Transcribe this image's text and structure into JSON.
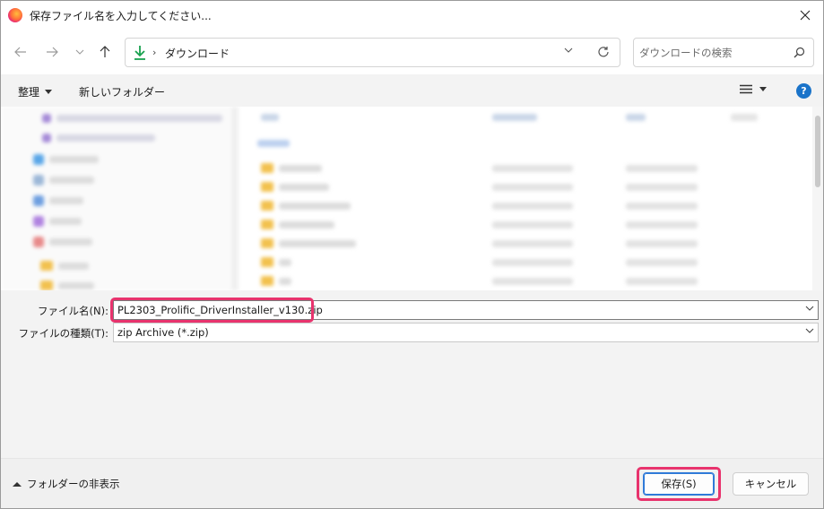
{
  "window": {
    "title": "保存ファイル名を入力してください..."
  },
  "nav": {
    "path": "ダウンロード",
    "search_placeholder": "ダウンロードの検索"
  },
  "toolbar": {
    "organize_label": "整理",
    "new_folder_label": "新しいフォルダー"
  },
  "fields": {
    "filename_label": "ファイル名(N):",
    "filename_value": "PL2303_Prolific_DriverInstaller_v130.zip",
    "filetype_label": "ファイルの種類(T):",
    "filetype_value": "zip Archive (*.zip)"
  },
  "footer": {
    "hide_folders_label": "フォルダーの非表示",
    "save_label": "保存(S)",
    "cancel_label": "キャンセル"
  },
  "colors": {
    "highlight": "#e8336d",
    "accent": "#1a73c9",
    "download_icon": "#18a14e"
  }
}
